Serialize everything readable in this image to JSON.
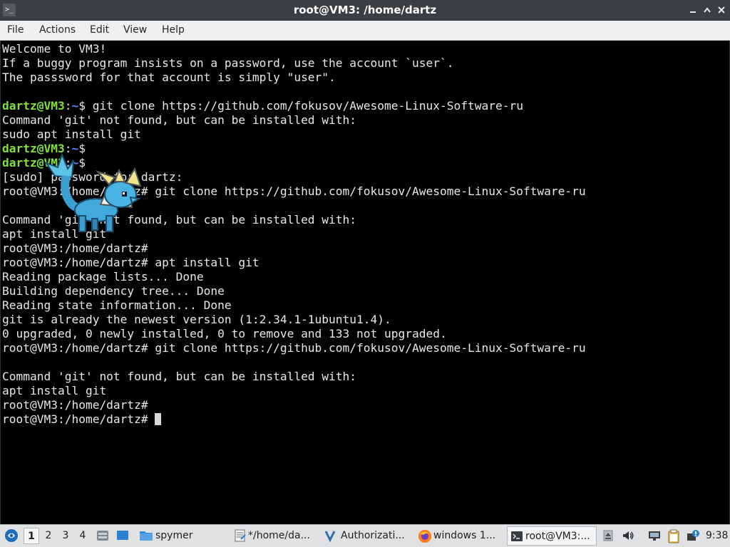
{
  "window": {
    "title": "root@VM3: /home/dartz",
    "app_icon": ">_",
    "minimize_icon": "minimize-icon",
    "maximize_icon": "maximize-icon",
    "close_icon": "close-icon"
  },
  "menu": {
    "file": "File",
    "actions": "Actions",
    "edit": "Edit",
    "view": "View",
    "help": "Help"
  },
  "terminal": {
    "lines": [
      "Welcome to VM3!",
      "If a buggy program insists on a password, use the account `user`.",
      "The passsword for that account is simply \"user\".",
      "",
      {
        "user": "dartz@VM3",
        "sep": ":",
        "path": "~",
        "end": "$ ",
        "cmd": "git clone https://github.com/fokusov/Awesome-Linux-Software-ru"
      },
      "Command 'git' not found, but can be installed with:",
      "sudo apt install git",
      {
        "user": "dartz@VM3",
        "sep": ":",
        "path": "~",
        "end": "$ ",
        "cmd": ""
      },
      {
        "user": "dartz@VM3",
        "sep": ":",
        "path": "~",
        "end": "$ ",
        "cmd": ""
      },
      "[sudo] password for dartz:",
      "root@VM3:/home/dartz# git clone https://github.com/fokusov/Awesome-Linux-Software-ru",
      "",
      "Command 'git' not found, but can be installed with:",
      "apt install git",
      "root@VM3:/home/dartz#",
      "root@VM3:/home/dartz# apt install git",
      "Reading package lists... Done",
      "Building dependency tree... Done",
      "Reading state information... Done",
      "git is already the newest version (1:2.34.1-1ubuntu1.4).",
      "0 upgraded, 0 newly installed, 0 to remove and 133 not upgraded.",
      "root@VM3:/home/dartz# git clone https://github.com/fokusov/Awesome-Linux-Software-ru",
      "",
      "Command 'git' not found, but can be installed with:",
      "apt install git",
      "root@VM3:/home/dartz#",
      "root@VM3:/home/dartz# "
    ],
    "colors": {
      "background": "#000000",
      "text": "#e8e8e8",
      "prompt_user": "#7fe239",
      "prompt_path": "#5f87ff"
    },
    "overlay_icon": "vaporeon-desktop-pet-icon"
  },
  "taskbar": {
    "start_icon": "start-menu-icon",
    "workspaces": [
      "1",
      "2",
      "3",
      "4"
    ],
    "active_workspace": "1",
    "quicklaunch": [
      "file-manager-icon",
      "show-desktop-icon"
    ],
    "tasks": [
      {
        "label": "spymer",
        "icon": "folder-icon"
      },
      {
        "label": "*/home/da...",
        "icon": "text-editor-icon"
      },
      {
        "label": "Authorizati...",
        "icon": "authorization-icon"
      },
      {
        "label": "windows 1...",
        "icon": "firefox-icon"
      },
      {
        "label": "root@VM3:...",
        "icon": "terminal-icon"
      }
    ],
    "tray": [
      "eject-icon",
      "volume-icon",
      "network-icon",
      "clipboard-icon",
      "update-notifier-icon"
    ],
    "clock": "9:38"
  }
}
